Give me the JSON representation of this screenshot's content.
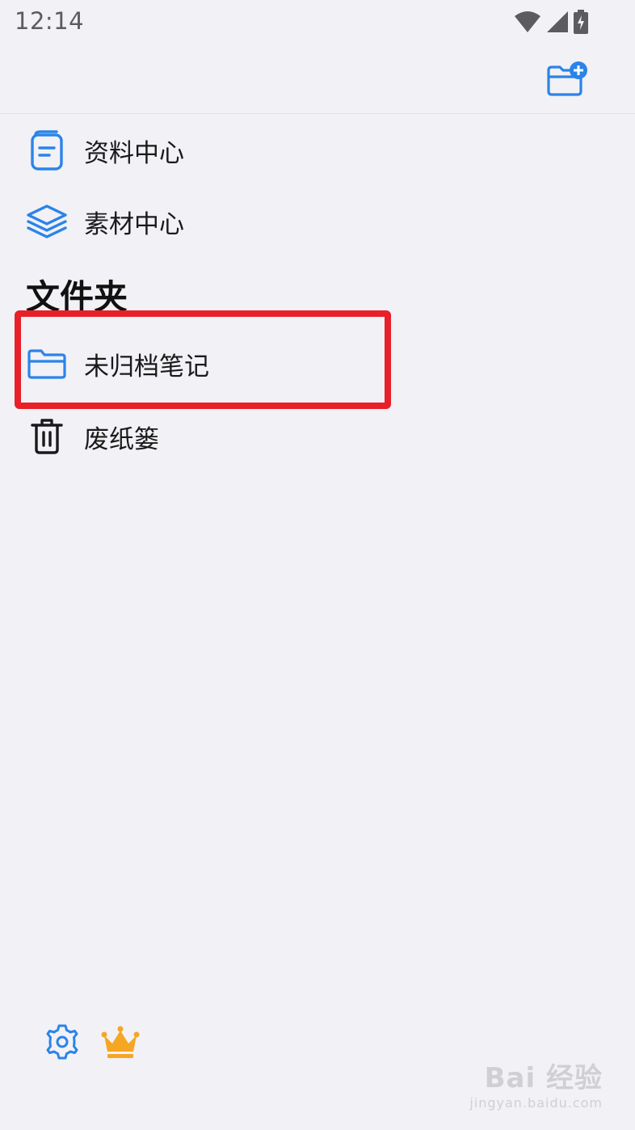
{
  "status_bar": {
    "time": "12:14",
    "icons": [
      "wifi-icon",
      "cellular-signal-icon",
      "battery-charging-icon"
    ]
  },
  "header": {
    "action_icon": "folder-add-icon"
  },
  "nav": {
    "items": [
      {
        "label": "资料中心",
        "icon": "document-icon"
      },
      {
        "label": "素材中心",
        "icon": "layers-icon"
      }
    ]
  },
  "folders": {
    "title": "文件夹",
    "items": [
      {
        "label": "未归档笔记",
        "icon": "folder-icon",
        "highlighted": true
      },
      {
        "label": "废纸篓",
        "icon": "trash-icon"
      }
    ]
  },
  "bottom": {
    "settings_icon": "gear-icon",
    "premium_icon": "crown-icon"
  },
  "watermark": {
    "logo": "Bai 经验",
    "url": "jingyan.baidu.com"
  },
  "colors": {
    "accent": "#2a84e9",
    "highlight": "#e8202a",
    "crown": "#f5a623",
    "background": "#f2f1f6"
  }
}
